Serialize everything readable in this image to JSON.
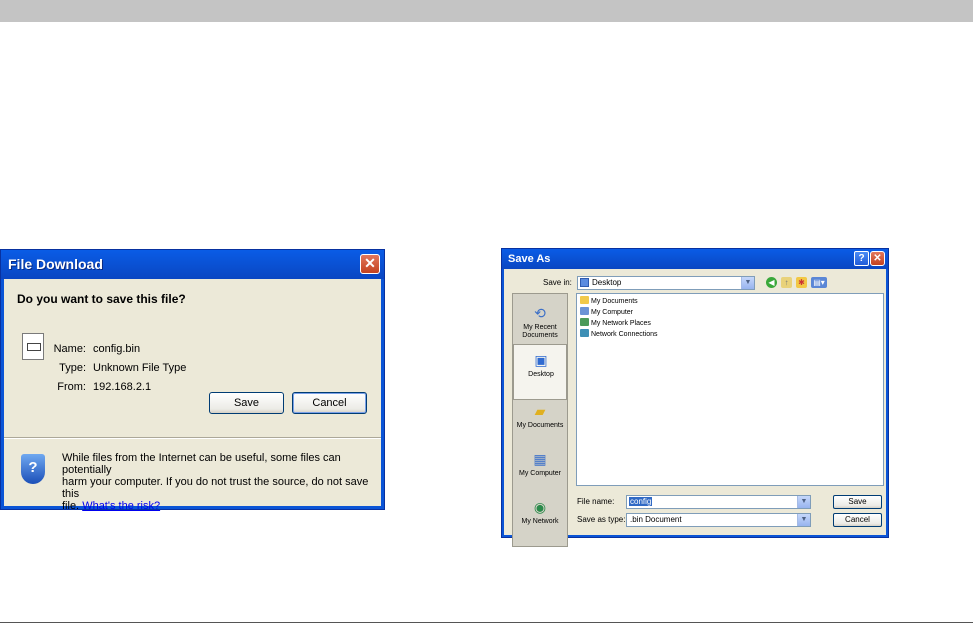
{
  "file_download": {
    "title": "File Download",
    "close_icon": "close-icon",
    "question": "Do you want to save this file?",
    "file_icon": "file-icon",
    "fields": [
      {
        "label": "Name:",
        "value": "config.bin"
      },
      {
        "label": "Type:",
        "value": "Unknown File Type"
      },
      {
        "label": "From:",
        "value": "192.168.2.1"
      }
    ],
    "save_label": "Save",
    "cancel_label": "Cancel",
    "shield_icon": "shield-help-icon",
    "warning_line1": "While files from the Internet can be useful, some files can potentially",
    "warning_line2": "harm your computer. If you do not trust the source, do not save this",
    "warning_line3_prefix": "file.",
    "warning_link": "What's the risk?"
  },
  "save_as": {
    "title": "Save As",
    "help_glyph": "?",
    "close_glyph": "✕",
    "save_in_label": "Save in:",
    "save_in_value": "Desktop",
    "toolbar_icons": [
      "back-icon",
      "up-folder-icon",
      "new-folder-icon",
      "views-icon"
    ],
    "places": [
      {
        "label": "My Recent Documents",
        "icon": "recent-documents-icon"
      },
      {
        "label": "Desktop",
        "icon": "desktop-icon"
      },
      {
        "label": "My Documents",
        "icon": "my-documents-icon"
      },
      {
        "label": "My Computer",
        "icon": "my-computer-icon"
      },
      {
        "label": "My Network",
        "icon": "my-network-icon"
      }
    ],
    "files": [
      {
        "name": "My Documents",
        "icon": "folder-icon"
      },
      {
        "name": "My Computer",
        "icon": "computer-icon"
      },
      {
        "name": "My Network Places",
        "icon": "network-places-icon"
      },
      {
        "name": "Network Connections",
        "icon": "network-connections-icon"
      }
    ],
    "file_name_label": "File name:",
    "file_name_value": "config",
    "save_as_type_label": "Save as type:",
    "save_as_type_value": ".bin Document",
    "save_label": "Save",
    "cancel_label": "Cancel"
  },
  "colors": {
    "xp_titlebar": "#0a54d6",
    "dialog_face": "#ece9d8",
    "top_band": "#c4c4c4"
  }
}
